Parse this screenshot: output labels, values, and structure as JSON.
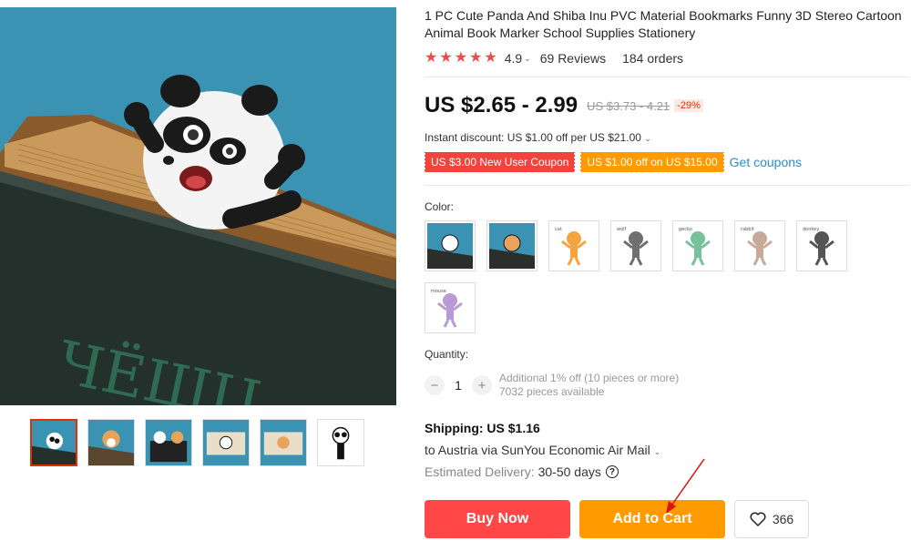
{
  "product": {
    "title": "1 PC Cute Panda And Shiba Inu PVC Material Bookmarks Funny 3D Stereo Cartoon Animal Book Marker School Supplies Stationery",
    "rating": "4.9",
    "reviews": "69 Reviews",
    "orders": "184 orders"
  },
  "price": {
    "current": "US $2.65 - 2.99",
    "original": "US $3.73 - 4.21",
    "discount": "-29%"
  },
  "instant_discount": "Instant discount: US $1.00 off per US $21.00",
  "coupons": {
    "new_user": "US $3.00 New User Coupon",
    "store": "US $1.00 off on US $15.00",
    "get_link": "Get coupons"
  },
  "color": {
    "label": "Color:",
    "options": [
      {
        "name": "panda",
        "caption": "",
        "bg": "#3a93b3",
        "body": "#ffffff"
      },
      {
        "name": "shiba",
        "caption": "",
        "bg": "#3a93b3",
        "body": "#e8a35c"
      },
      {
        "name": "cat",
        "caption": "cat",
        "bg": "#ffffff",
        "body": "#f5a441"
      },
      {
        "name": "wolf",
        "caption": "wolf",
        "bg": "#ffffff",
        "body": "#6f6f6f"
      },
      {
        "name": "gecko",
        "caption": "gecko",
        "bg": "#ffffff",
        "body": "#77c29a"
      },
      {
        "name": "rabbit",
        "caption": "rabbit",
        "bg": "#ffffff",
        "body": "#c9a99a"
      },
      {
        "name": "donkey",
        "caption": "donkey",
        "bg": "#ffffff",
        "body": "#555555"
      },
      {
        "name": "mouse",
        "caption": "mouse",
        "bg": "#ffffff",
        "body": "#b79ad6"
      }
    ]
  },
  "quantity": {
    "label": "Quantity:",
    "value": "1",
    "minus": "−",
    "plus": "+",
    "note1": "Additional 1% off (10 pieces or more)",
    "note2": "7032 pieces available"
  },
  "shipping": {
    "title": "Shipping: US $1.16",
    "to": "to Austria via SunYou Economic Air Mail",
    "est_label": "Estimated Delivery:",
    "est_value": "30-50 days"
  },
  "actions": {
    "buy": "Buy Now",
    "cart": "Add to Cart",
    "wish_count": "366"
  },
  "colors": {
    "accent_red": "#ff4747",
    "accent_orange": "#ff9a00",
    "star": "#f04a4a",
    "link": "#2f8fc1"
  }
}
